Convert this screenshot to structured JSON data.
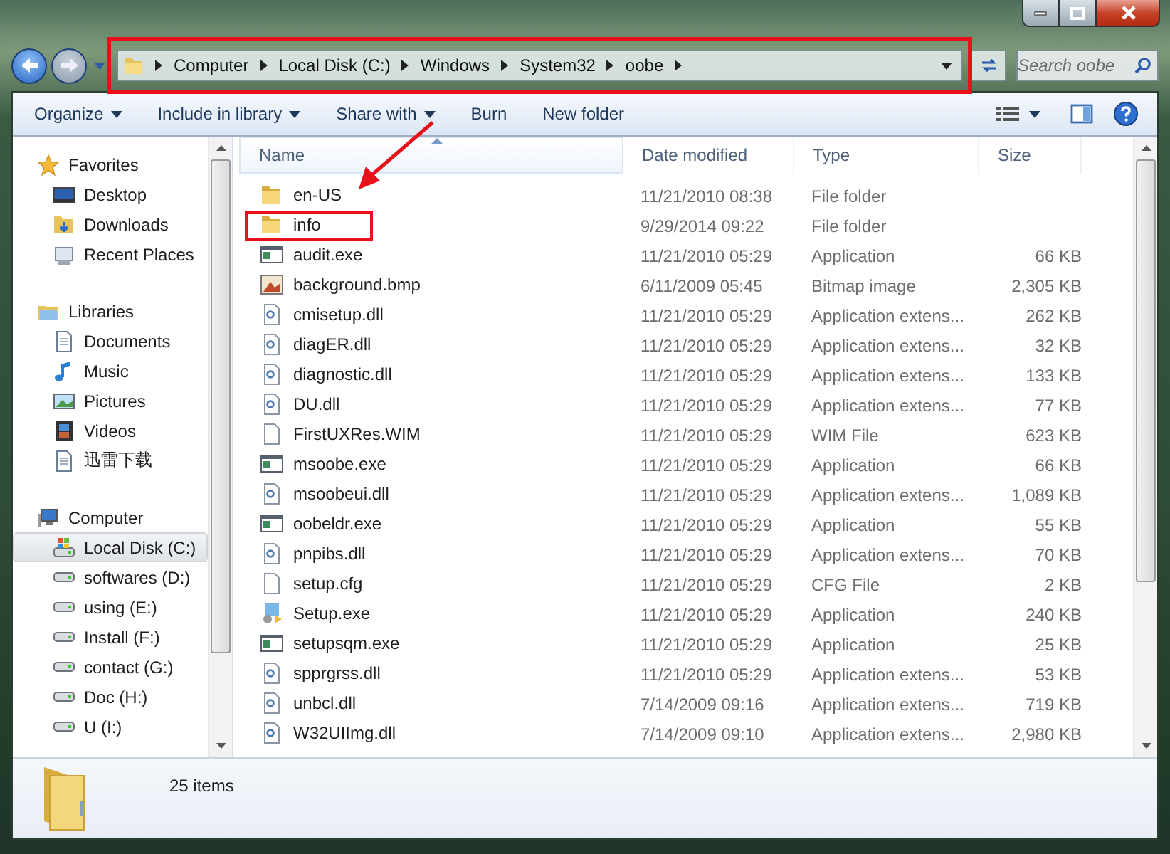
{
  "address_bar": {
    "highlighted": true,
    "path": [
      "Computer",
      "Local Disk (C:)",
      "Windows",
      "System32",
      "oobe"
    ]
  },
  "search": {
    "placeholder": "Search oobe"
  },
  "toolbar": {
    "items": [
      {
        "label": "Organize",
        "dropdown": true
      },
      {
        "label": "Include in library",
        "dropdown": true
      },
      {
        "label": "Share with",
        "dropdown": true
      },
      {
        "label": "Burn",
        "dropdown": false
      },
      {
        "label": "New folder",
        "dropdown": false
      }
    ]
  },
  "navigation": [
    {
      "label": "Favorites",
      "kind": "star",
      "selected": false,
      "children": [
        {
          "label": "Desktop",
          "kind": "desktop",
          "selected": false
        },
        {
          "label": "Downloads",
          "kind": "downloads",
          "selected": false
        },
        {
          "label": "Recent Places",
          "kind": "recent",
          "selected": false
        }
      ]
    },
    {
      "label": "Libraries",
      "kind": "library",
      "selected": false,
      "children": [
        {
          "label": "Documents",
          "kind": "documents",
          "selected": false
        },
        {
          "label": "Music",
          "kind": "music",
          "selected": false
        },
        {
          "label": "Pictures",
          "kind": "pictures",
          "selected": false
        },
        {
          "label": "Videos",
          "kind": "videos",
          "selected": false
        },
        {
          "label": "迅雷下载",
          "kind": "library-folder",
          "selected": false
        }
      ]
    },
    {
      "label": "Computer",
      "kind": "computer",
      "selected": false,
      "children": [
        {
          "label": "Local Disk (C:)",
          "kind": "system-drive",
          "selected": true
        },
        {
          "label": "softwares (D:)",
          "kind": "drive",
          "selected": false
        },
        {
          "label": "using (E:)",
          "kind": "drive",
          "selected": false
        },
        {
          "label": "Install (F:)",
          "kind": "drive",
          "selected": false
        },
        {
          "label": "contact (G:)",
          "kind": "drive",
          "selected": false
        },
        {
          "label": "Doc (H:)",
          "kind": "drive",
          "selected": false
        },
        {
          "label": "U (I:)",
          "kind": "drive",
          "selected": false
        }
      ]
    }
  ],
  "table": {
    "columns": [
      {
        "label": "Name",
        "sorted": true
      },
      {
        "label": "Date modified",
        "sorted": false
      },
      {
        "label": "Type",
        "sorted": false
      },
      {
        "label": "Size",
        "sorted": false
      }
    ],
    "rows": [
      {
        "name": "en-US",
        "kind": "folder",
        "highlighted": false,
        "date": "11/21/2010 08:38",
        "type": "File folder",
        "size": ""
      },
      {
        "name": "info",
        "kind": "folder",
        "highlighted": true,
        "date": "9/29/2014 09:22",
        "type": "File folder",
        "size": ""
      },
      {
        "name": "audit.exe",
        "kind": "exe",
        "highlighted": false,
        "date": "11/21/2010 05:29",
        "type": "Application",
        "size": "66 KB"
      },
      {
        "name": "background.bmp",
        "kind": "bmp",
        "highlighted": false,
        "date": "6/11/2009 05:45",
        "type": "Bitmap image",
        "size": "2,305 KB"
      },
      {
        "name": "cmisetup.dll",
        "kind": "dll",
        "highlighted": false,
        "date": "11/21/2010 05:29",
        "type": "Application extens...",
        "size": "262 KB"
      },
      {
        "name": "diagER.dll",
        "kind": "dll",
        "highlighted": false,
        "date": "11/21/2010 05:29",
        "type": "Application extens...",
        "size": "32 KB"
      },
      {
        "name": "diagnostic.dll",
        "kind": "dll",
        "highlighted": false,
        "date": "11/21/2010 05:29",
        "type": "Application extens...",
        "size": "133 KB"
      },
      {
        "name": "DU.dll",
        "kind": "dll",
        "highlighted": false,
        "date": "11/21/2010 05:29",
        "type": "Application extens...",
        "size": "77 KB"
      },
      {
        "name": "FirstUXRes.WIM",
        "kind": "file",
        "highlighted": false,
        "date": "11/21/2010 05:29",
        "type": "WIM File",
        "size": "623 KB"
      },
      {
        "name": "msoobe.exe",
        "kind": "exe",
        "highlighted": false,
        "date": "11/21/2010 05:29",
        "type": "Application",
        "size": "66 KB"
      },
      {
        "name": "msoobeui.dll",
        "kind": "dll",
        "highlighted": false,
        "date": "11/21/2010 05:29",
        "type": "Application extens...",
        "size": "1,089 KB"
      },
      {
        "name": "oobeldr.exe",
        "kind": "exe",
        "highlighted": false,
        "date": "11/21/2010 05:29",
        "type": "Application",
        "size": "55 KB"
      },
      {
        "name": "pnpibs.dll",
        "kind": "dll",
        "highlighted": false,
        "date": "11/21/2010 05:29",
        "type": "Application extens...",
        "size": "70 KB"
      },
      {
        "name": "setup.cfg",
        "kind": "file",
        "highlighted": false,
        "date": "11/21/2010 05:29",
        "type": "CFG File",
        "size": "2 KB"
      },
      {
        "name": "Setup.exe",
        "kind": "setup",
        "highlighted": false,
        "date": "11/21/2010 05:29",
        "type": "Application",
        "size": "240 KB"
      },
      {
        "name": "setupsqm.exe",
        "kind": "exe",
        "highlighted": false,
        "date": "11/21/2010 05:29",
        "type": "Application",
        "size": "25 KB"
      },
      {
        "name": "spprgrss.dll",
        "kind": "dll",
        "highlighted": false,
        "date": "11/21/2010 05:29",
        "type": "Application extens...",
        "size": "53 KB"
      },
      {
        "name": "unbcl.dll",
        "kind": "dll",
        "highlighted": false,
        "date": "7/14/2009 09:16",
        "type": "Application extens...",
        "size": "719 KB"
      },
      {
        "name": "W32UIImg.dll",
        "kind": "dll",
        "highlighted": false,
        "date": "7/14/2009 09:10",
        "type": "Application extens...",
        "size": "2,980 KB"
      }
    ]
  },
  "details": {
    "count": "25 items"
  }
}
